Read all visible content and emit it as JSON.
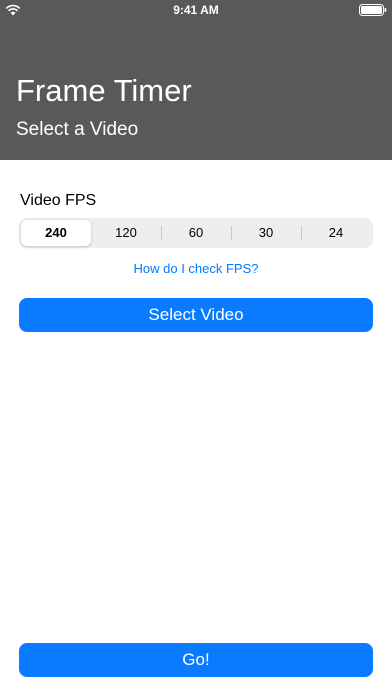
{
  "status_bar": {
    "time": "9:41 AM",
    "icons": [
      "wifi-icon",
      "battery-icon"
    ]
  },
  "header": {
    "title": "Frame Timer",
    "subtitle": "Select a Video",
    "background_color": "#595959"
  },
  "fps": {
    "label": "Video FPS",
    "options": [
      "240",
      "120",
      "60",
      "30",
      "24"
    ],
    "selected": "240"
  },
  "help_link": "How do I check FPS?",
  "select_video_label": "Select Video",
  "go_label": "Go!",
  "colors": {
    "accent": "#0a7aff",
    "link": "#007aff"
  }
}
